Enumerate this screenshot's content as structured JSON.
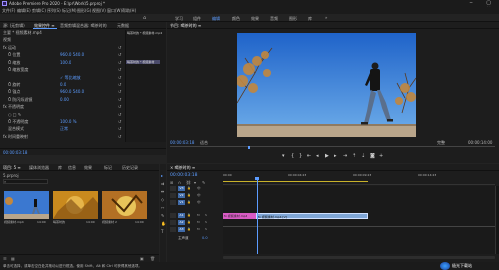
{
  "titlebar": {
    "title": "Adobe Premiere Pro 2020 - E:\\pr\\Work\\5.prproj *"
  },
  "menubar": {
    "items": [
      "文件(F)",
      "编辑(E)",
      "剪辑(C)",
      "序列(S)",
      "标记(M)",
      "图形(G)",
      "视图(V)",
      "窗口(W)",
      "帮助(H)"
    ]
  },
  "workspaces": {
    "items": [
      "学习",
      "组件",
      "编辑",
      "颜色",
      "效果",
      "音频",
      "图形",
      "库"
    ],
    "active_index": 2
  },
  "effect_controls": {
    "tabs": [
      "源: (无剪辑)",
      "效果控件 ≡",
      "音频剪辑混合器: 喝茶时的",
      "元数据"
    ],
    "active_tab": 1,
    "source_label": "主要 * 视频素材.mp4",
    "clip_label": "喝茶时的 * 视频素材.mp4",
    "section_video": "视频",
    "rows": [
      {
        "label": "fx  运动",
        "value": "",
        "indent": 0
      },
      {
        "label": "Ö 位置",
        "value": "960.0   540.0",
        "indent": 1
      },
      {
        "label": "Ö 缩放",
        "value": "100.0",
        "indent": 1
      },
      {
        "label": "Ö 缩放宽度",
        "value": "",
        "indent": 1
      },
      {
        "label": "",
        "value": "✓ 等比缩放",
        "indent": 1
      },
      {
        "label": "Ö 旋转",
        "value": "0.0",
        "indent": 1
      },
      {
        "label": "Ö 锚点",
        "value": "960.0   540.0",
        "indent": 1
      },
      {
        "label": "Ö 防闪烁滤镜",
        "value": "0.00",
        "indent": 1
      },
      {
        "label": "fx  不透明度",
        "value": "",
        "indent": 0
      },
      {
        "label": "○ □ ✎",
        "value": "",
        "indent": 1
      },
      {
        "label": "Ö 不透明度",
        "value": "100.0 %",
        "indent": 1
      },
      {
        "label": "混合模式",
        "value": "正常",
        "indent": 1
      },
      {
        "label": "fx  时间重映射",
        "value": "",
        "indent": 0
      }
    ],
    "clip_bar_label": "喝茶时的 * 视频素材"
  },
  "program_monitor": {
    "tabs": [
      "节目: 喝茶时的 ≡"
    ],
    "timecode": "00:00:03:18",
    "fit": "适合",
    "quality": "完整",
    "duration": "00:00:14:00"
  },
  "project_panel": {
    "tabs": [
      "项目: 5 ≡",
      "媒体浏览器",
      "库",
      "信息",
      "效果",
      "标记",
      "历史记录"
    ],
    "path": "5.prproj",
    "items": [
      {
        "name": "视频素材.mp4",
        "duration": "14:00",
        "color": "#3b6fb0"
      },
      {
        "name": "喝茶时的",
        "duration": "14:00",
        "color": "#c58019"
      },
      {
        "name": "视频素材 2",
        "duration": "14:00",
        "color": "#b37024"
      }
    ]
  },
  "timeline": {
    "tabs": [
      "× 喝茶时的 ≡"
    ],
    "timecode": "00:00:03:18",
    "ruler": [
      "00:00",
      "00:00:04:23",
      "00:00:09:23",
      "00:00:14:23"
    ],
    "video_tracks": [
      "V3",
      "V2",
      "V1"
    ],
    "audio_tracks": [
      "A1",
      "A2",
      "A3"
    ],
    "master": "主声道",
    "master_value": "0.0",
    "clips": [
      {
        "label": "fx 视频素材.mp4",
        "track": "V1",
        "color": "#d85bc4"
      },
      {
        "label": "fx 视频素材.mp4 [V]",
        "track": "V1",
        "color": "#7fa6d6"
      }
    ]
  },
  "statusbar": {
    "text": "单击可选择，或单击空白处并拖动以进行框选。使用 Shift、Alt 和 Ctrl 可获得其他选项。"
  },
  "watermark": {
    "text": "极光下载站"
  }
}
